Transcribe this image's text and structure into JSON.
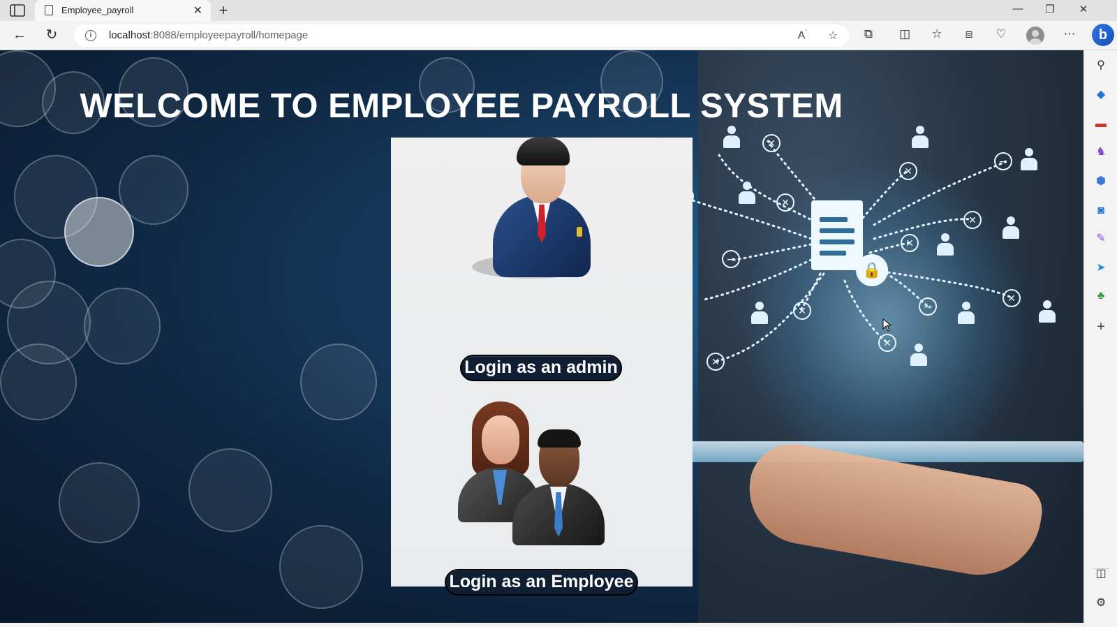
{
  "browser": {
    "tab_title": "Employee_payroll",
    "tab_close": "✕",
    "new_tab": "+",
    "url_host": "localhost",
    "url_path": ":8088/employeepayroll/homepage",
    "window_controls": {
      "minimize": "—",
      "restore": "❐",
      "close": "✕"
    },
    "nav": {
      "back": "←",
      "refresh": "↻"
    }
  },
  "page": {
    "title": "WELCOME TO EMPLOYEE PAYROLL SYSTEM",
    "admin_button": "Login as an admin",
    "employee_button": "Login as an Employee"
  },
  "icons": {
    "sidebar": [
      "search-icon",
      "tag-icon",
      "briefcase-icon",
      "games-icon",
      "office-icon",
      "outlook-icon",
      "designer-icon",
      "send-icon",
      "tree-icon",
      "add-icon",
      "split-icon",
      "settings-icon"
    ]
  }
}
